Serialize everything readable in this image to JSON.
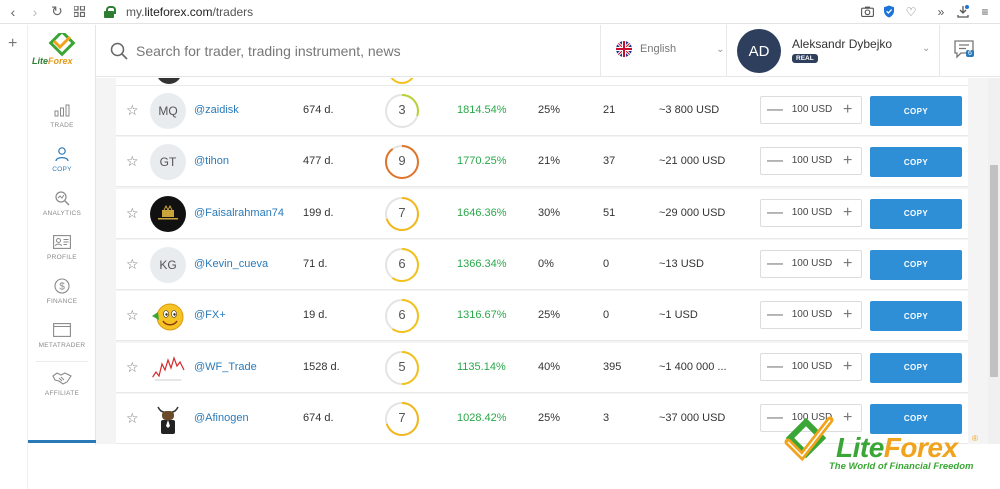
{
  "browser": {
    "url_prefix": "my.",
    "url_host": "liteforex.com",
    "url_path": "/traders"
  },
  "header": {
    "search_placeholder": "Search for trader, trading instrument, news",
    "language": "English",
    "avatar_initials": "AD",
    "user_name": "Aleksandr Dybejko",
    "account_badge": "REAL",
    "notification_count": "6"
  },
  "sidebar": {
    "logo_text_lite": "LiteForex",
    "items": [
      {
        "label": "TRADE",
        "icon": "chart-icon"
      },
      {
        "label": "COPY",
        "icon": "copy-users-icon"
      },
      {
        "label": "ANALYTICS",
        "icon": "analytics-icon"
      },
      {
        "label": "PROFILE",
        "icon": "profile-card-icon"
      },
      {
        "label": "FINANCE",
        "icon": "dollar-icon"
      },
      {
        "label": "METATRADER",
        "icon": "window-icon"
      },
      {
        "label": "AFFILIATE",
        "icon": "handshake-icon"
      }
    ]
  },
  "traders": [
    {
      "initials": "MQ",
      "username": "@zaidisk",
      "days": "674 d.",
      "risk": "3",
      "risk_fill": 0.3,
      "risk_color": "#b5d335",
      "profit": "1814.54%",
      "drawdown": "25%",
      "copiers": "21",
      "funds": "~3 800 USD",
      "amount": "100 USD",
      "copy_label": "COPY",
      "avatar_type": "initials"
    },
    {
      "initials": "GT",
      "username": "@tihon",
      "days": "477 d.",
      "risk": "9",
      "risk_fill": 0.9,
      "risk_color": "#e0752a",
      "profit": "1770.25%",
      "drawdown": "21%",
      "copiers": "37",
      "funds": "~21 000 USD",
      "amount": "100 USD",
      "copy_label": "COPY",
      "avatar_type": "initials"
    },
    {
      "initials": "",
      "username": "@Faisalrahman74",
      "days": "199 d.",
      "risk": "7",
      "risk_fill": 0.7,
      "risk_color": "#f2b71b",
      "profit": "1646.36%",
      "drawdown": "30%",
      "copiers": "51",
      "funds": "~29 000 USD",
      "amount": "100 USD",
      "copy_label": "COPY",
      "avatar_type": "black-logo"
    },
    {
      "initials": "KG",
      "username": "@Kevin_cueva",
      "days": "71 d.",
      "risk": "6",
      "risk_fill": 0.6,
      "risk_color": "#f2c21b",
      "profit": "1366.34%",
      "drawdown": "0%",
      "copiers": "0",
      "funds": "~13 USD",
      "amount": "100 USD",
      "copy_label": "COPY",
      "avatar_type": "initials"
    },
    {
      "initials": "",
      "username": "@FX+",
      "days": "19 d.",
      "risk": "6",
      "risk_fill": 0.6,
      "risk_color": "#f2c21b",
      "profit": "1316.67%",
      "drawdown": "25%",
      "copiers": "0",
      "funds": "~1 USD",
      "amount": "100 USD",
      "copy_label": "COPY",
      "avatar_type": "smiley"
    },
    {
      "initials": "",
      "username": "@WF_Trade",
      "days": "1528 d.",
      "risk": "5",
      "risk_fill": 0.5,
      "risk_color": "#f2c21b",
      "profit": "1135.14%",
      "drawdown": "40%",
      "copiers": "395",
      "funds": "~1 400 000 ...",
      "amount": "100 USD",
      "copy_label": "COPY",
      "avatar_type": "chart"
    },
    {
      "initials": "",
      "username": "@Afinogen",
      "days": "674 d.",
      "risk": "7",
      "risk_fill": 0.7,
      "risk_color": "#f2b71b",
      "profit": "1028.42%",
      "drawdown": "25%",
      "copiers": "3",
      "funds": "~37 000 USD",
      "amount": "100 USD",
      "copy_label": "COPY",
      "avatar_type": "bull"
    }
  ],
  "watermark": {
    "brand_lite": "Lite",
    "brand_forex": "Forex",
    "registered": "®",
    "tagline": "The World of Financial Freedom"
  },
  "colors": {
    "accent_blue": "#2e8ed6",
    "profit_green": "#2aa84a",
    "avatar_navy": "#2d3f5c",
    "brand_green": "#3aa635",
    "brand_orange": "#f0a31c"
  }
}
